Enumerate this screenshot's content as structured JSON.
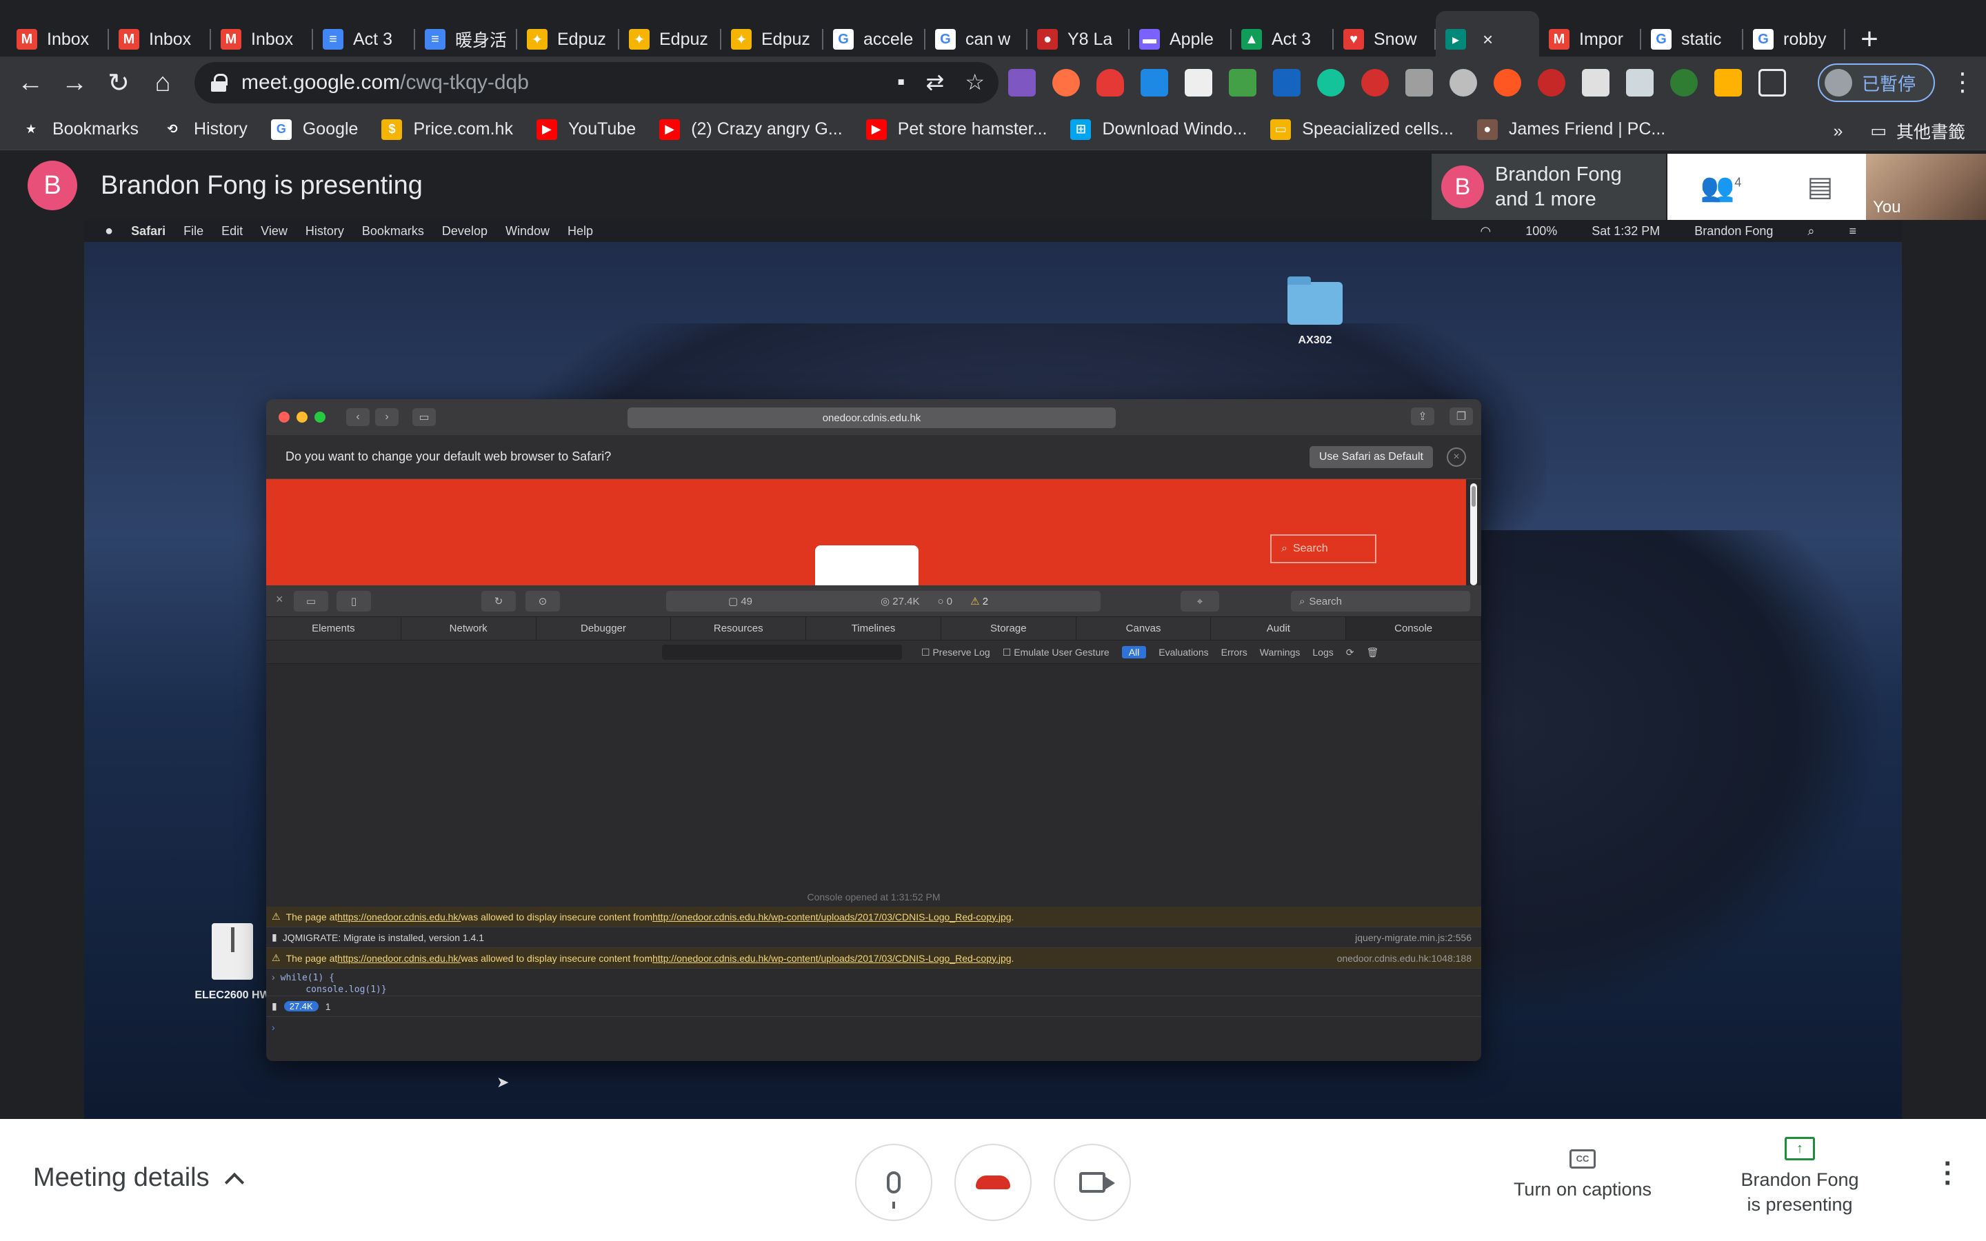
{
  "browser": {
    "tabs": [
      {
        "title": "Inbox",
        "icon": "gmail-icon",
        "color": "#ea4335",
        "glyph": "M"
      },
      {
        "title": "Inbox",
        "icon": "gmail-icon",
        "color": "#ea4335",
        "glyph": "M"
      },
      {
        "title": "Inbox",
        "icon": "gmail-icon",
        "color": "#ea4335",
        "glyph": "M"
      },
      {
        "title": "Act 3",
        "icon": "google-docs-icon",
        "color": "#4285f4",
        "glyph": "≡"
      },
      {
        "title": "暖身活",
        "icon": "google-docs-icon",
        "color": "#4285f4",
        "glyph": "≡"
      },
      {
        "title": "Edpuz",
        "icon": "edpuzzle-icon",
        "color": "#f4b400",
        "glyph": "✦"
      },
      {
        "title": "Edpuz",
        "icon": "edpuzzle-icon",
        "color": "#f4b400",
        "glyph": "✦"
      },
      {
        "title": "Edpuz",
        "icon": "edpuzzle-icon",
        "color": "#f4b400",
        "glyph": "✦"
      },
      {
        "title": "accele",
        "icon": "google-icon",
        "color": "#ffffff",
        "glyph": "G"
      },
      {
        "title": "can w",
        "icon": "google-icon",
        "color": "#ffffff",
        "glyph": "G"
      },
      {
        "title": "Y8 La",
        "icon": "y8-icon",
        "color": "#c62828",
        "glyph": "●"
      },
      {
        "title": "Apple",
        "icon": "apple-icon",
        "color": "#7b61ff",
        "glyph": "▬"
      },
      {
        "title": "Act 3",
        "icon": "google-drive-icon",
        "color": "#0f9d58",
        "glyph": "▲"
      },
      {
        "title": "Snow",
        "icon": "heart-icon",
        "color": "#e53935",
        "glyph": "♥"
      },
      {
        "title": "",
        "icon": "google-meet-icon",
        "color": "#00897b",
        "glyph": "▸",
        "active": true
      },
      {
        "title": "Impor",
        "icon": "gmail-icon",
        "color": "#ea4335",
        "glyph": "M"
      },
      {
        "title": "static",
        "icon": "google-icon",
        "color": "#ffffff",
        "glyph": "G"
      },
      {
        "title": "robby",
        "icon": "google-icon",
        "color": "#ffffff",
        "glyph": "G"
      }
    ],
    "url_host": "meet.google.com",
    "url_path": "/cwq-tkqy-dqb",
    "profile_label": "已暫停",
    "bookmarks": [
      {
        "label": "Bookmarks",
        "icon": "star-icon",
        "color": "#35363a",
        "glyph": "★"
      },
      {
        "label": "History",
        "icon": "history-icon",
        "color": "#35363a",
        "glyph": "⟲"
      },
      {
        "label": "Google",
        "icon": "google-icon",
        "color": "#ffffff",
        "glyph": "G"
      },
      {
        "label": "Price.com.hk",
        "icon": "price-icon",
        "color": "#f4b400",
        "glyph": "$"
      },
      {
        "label": "YouTube",
        "icon": "youtube-icon",
        "color": "#ff0000",
        "glyph": "▶"
      },
      {
        "label": "(2) Crazy angry G...",
        "icon": "youtube-icon",
        "color": "#ff0000",
        "glyph": "▶"
      },
      {
        "label": "Pet store hamster...",
        "icon": "youtube-icon",
        "color": "#ff0000",
        "glyph": "▶"
      },
      {
        "label": "Download Windo...",
        "icon": "windows-icon",
        "color": "#00a4ef",
        "glyph": "⊞"
      },
      {
        "label": "Speacialized cells...",
        "icon": "slides-icon",
        "color": "#f4b400",
        "glyph": "▭"
      },
      {
        "label": "James Friend | PC...",
        "icon": "site-icon",
        "color": "#795548",
        "glyph": "●"
      }
    ],
    "other_bookmarks": "其他書籤"
  },
  "meet": {
    "presenter_initial": "B",
    "presenting_text": "Brandon Fong is presenting",
    "participant_tile_line1": "Brandon Fong",
    "participant_tile_line2": "and 1 more",
    "participant_count": "4",
    "self_label": "You",
    "meeting_details": "Meeting details",
    "captions_label": "Turn on captions",
    "presenting_line1": "Brandon Fong",
    "presenting_line2": "is presenting",
    "cc_glyph": "CC",
    "colors": {
      "avatar": "#e8507a",
      "end_call": "#d93025",
      "present": "#1e8e3e"
    }
  },
  "shared_screen": {
    "menubar": {
      "apple": "",
      "items": [
        "Safari",
        "File",
        "Edit",
        "View",
        "History",
        "Bookmarks",
        "Develop",
        "Window",
        "Help"
      ],
      "status_battery": "100%",
      "status_time": "Sat 1:32 PM",
      "status_user": "Brandon Fong"
    },
    "desktop_icons": [
      {
        "label": "AX302",
        "type": "folder"
      },
      {
        "label": "ELEC2600 HW",
        "type": "zip"
      }
    ],
    "safari": {
      "url": "onedoor.cdnis.edu.hk",
      "banner_text": "Do you want to change your default web browser to Safari?",
      "banner_button": "Use Safari as Default",
      "page_search_placeholder": "Search",
      "inspector": {
        "toolbar_resources": "49",
        "toolbar_size": "27.4K",
        "toolbar_errors": "0",
        "toolbar_warnings": "2",
        "search_placeholder": "Search",
        "tabs": [
          "Elements",
          "Network",
          "Debugger",
          "Resources",
          "Timelines",
          "Storage",
          "Canvas",
          "Audit",
          "Console"
        ],
        "filters": {
          "preserve_log": "Preserve Log",
          "emulate_gesture": "Emulate User Gesture",
          "all": "All",
          "evaluations": "Evaluations",
          "errors": "Errors",
          "warnings": "Warnings",
          "logs": "Logs"
        },
        "console_opened": "Console opened at 1:31:52 PM",
        "logs": [
          {
            "type": "warn",
            "prefix": "The page at ",
            "link1": "https://onedoor.cdnis.edu.hk/",
            "middle": " was allowed to display insecure content from ",
            "link2": "http://onedoor.cdnis.edu.hk/wp-content/uploads/2017/03/CDNIS-Logo_Red-copy.jpg",
            "suffix": ".",
            "source": ""
          },
          {
            "type": "info",
            "text": "JQMIGRATE: Migrate is installed, version 1.4.1",
            "source": "jquery-migrate.min.js:2:556"
          },
          {
            "type": "warn",
            "prefix": "The page at ",
            "link1": "https://onedoor.cdnis.edu.hk/",
            "middle": " was allowed to display insecure content from ",
            "link2": "http://onedoor.cdnis.edu.hk/wp-content/uploads/2017/03/CDNIS-Logo_Red-copy.jpg",
            "suffix": ".",
            "source": "onedoor.cdnis.edu.hk:1048:188"
          }
        ],
        "input_line1": "while(1) {",
        "input_line2": "    console.log(1)}",
        "output_count": "27.4K",
        "output_value": "1"
      }
    }
  }
}
